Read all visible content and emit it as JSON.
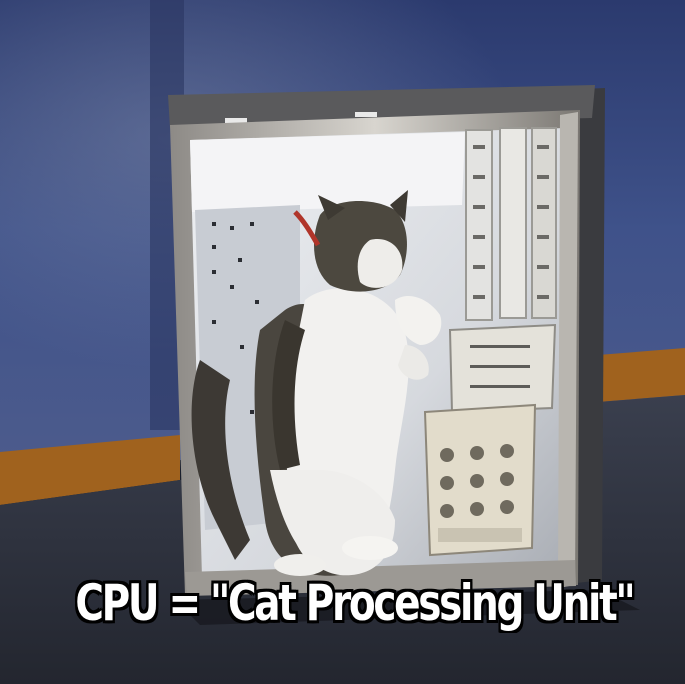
{
  "caption": "CPU = \"Cat Processing Unit\"",
  "colors": {
    "wall": "#3d4f86",
    "floor": "#2f3442",
    "baseboard": "#a0621e",
    "case_frame": "#c9c6c0",
    "case_interior": "#dcdfe4",
    "cat_dark": "#4a4640",
    "cat_white": "#f2f1ef",
    "caption_text": "#ffffff"
  }
}
